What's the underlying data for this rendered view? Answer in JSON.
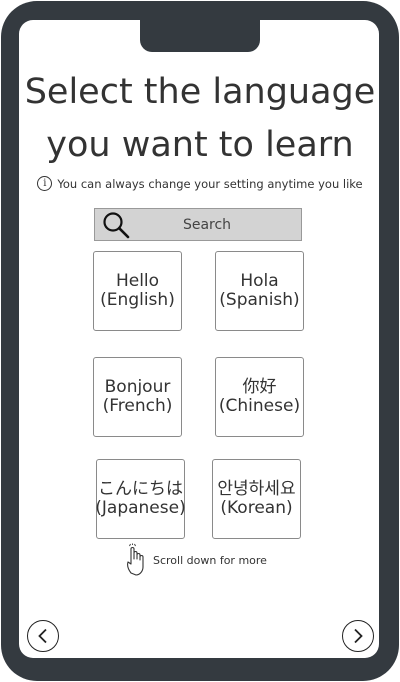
{
  "title": {
    "line1": "Select the language",
    "line2": "you want to learn"
  },
  "info": {
    "icon_glyph": "i",
    "text": "You can always change your setting anytime you like"
  },
  "search": {
    "placeholder": "Search"
  },
  "languages": [
    {
      "greeting": "Hello",
      "name": "(English)"
    },
    {
      "greeting": "Hola",
      "name": "(Spanish)"
    },
    {
      "greeting": "Bonjour",
      "name": "(French)"
    },
    {
      "greeting": "你好",
      "name": "(Chinese)"
    },
    {
      "greeting": "こんにちは",
      "name": "(Japanese)"
    },
    {
      "greeting": "안녕하세요",
      "name": "(Korean)"
    }
  ],
  "scroll_hint": {
    "text": "Scroll down for more"
  },
  "navigation": {
    "back_icon": "chevron-left-icon",
    "next_icon": "chevron-right-icon"
  },
  "colors": {
    "frame": "#343a40",
    "search_bg": "#d3d3d3"
  }
}
